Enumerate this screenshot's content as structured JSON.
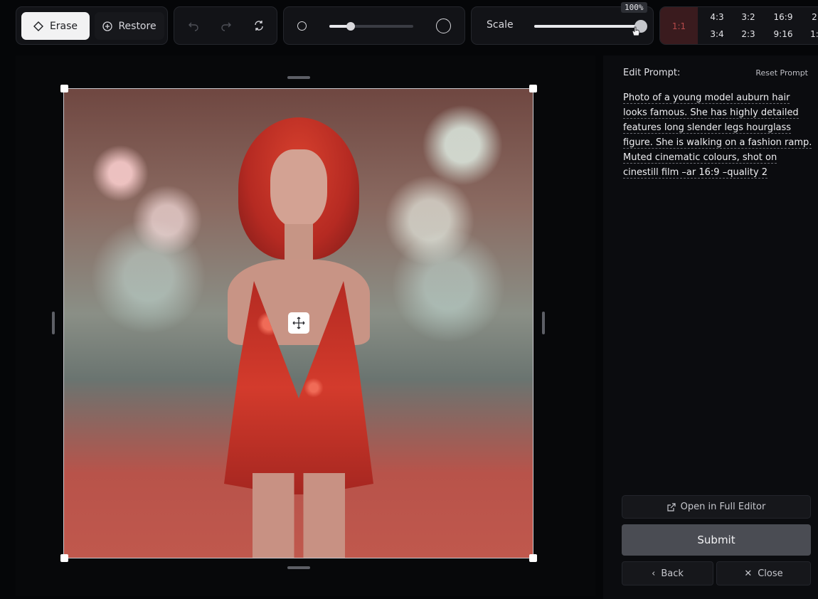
{
  "toolbar": {
    "erase_label": "Erase",
    "restore_label": "Restore",
    "scale_label": "Scale",
    "scale_value": 100,
    "scale_tooltip": "100%",
    "brush_size_fraction": 0.25,
    "aspect_ratios": {
      "active": "1:1",
      "row1": [
        "4:3",
        "3:2",
        "16:9",
        "2"
      ],
      "row2": [
        "3:4",
        "2:3",
        "9:16",
        "1:"
      ]
    }
  },
  "editor": {
    "prompt_heading": "Edit Prompt:",
    "reset_label": "Reset Prompt",
    "prompt_lines": [
      "Photo of a young model auburn hair",
      "looks famous. She has highly detailed",
      "features long slender legs hourglass",
      "figure. She is walking on a fashion ramp.",
      "Muted cinematic colours, shot on",
      "cinestill film –ar 16:9 –quality 2"
    ],
    "open_full_editor_label": "Open in Full Editor",
    "submit_label": "Submit",
    "back_label": "Back",
    "close_label": "Close"
  },
  "colors": {
    "background": "#050608",
    "panel": "#121317",
    "accent_active_ratio": "#3a1b1e",
    "submit": "#4a4c53"
  }
}
